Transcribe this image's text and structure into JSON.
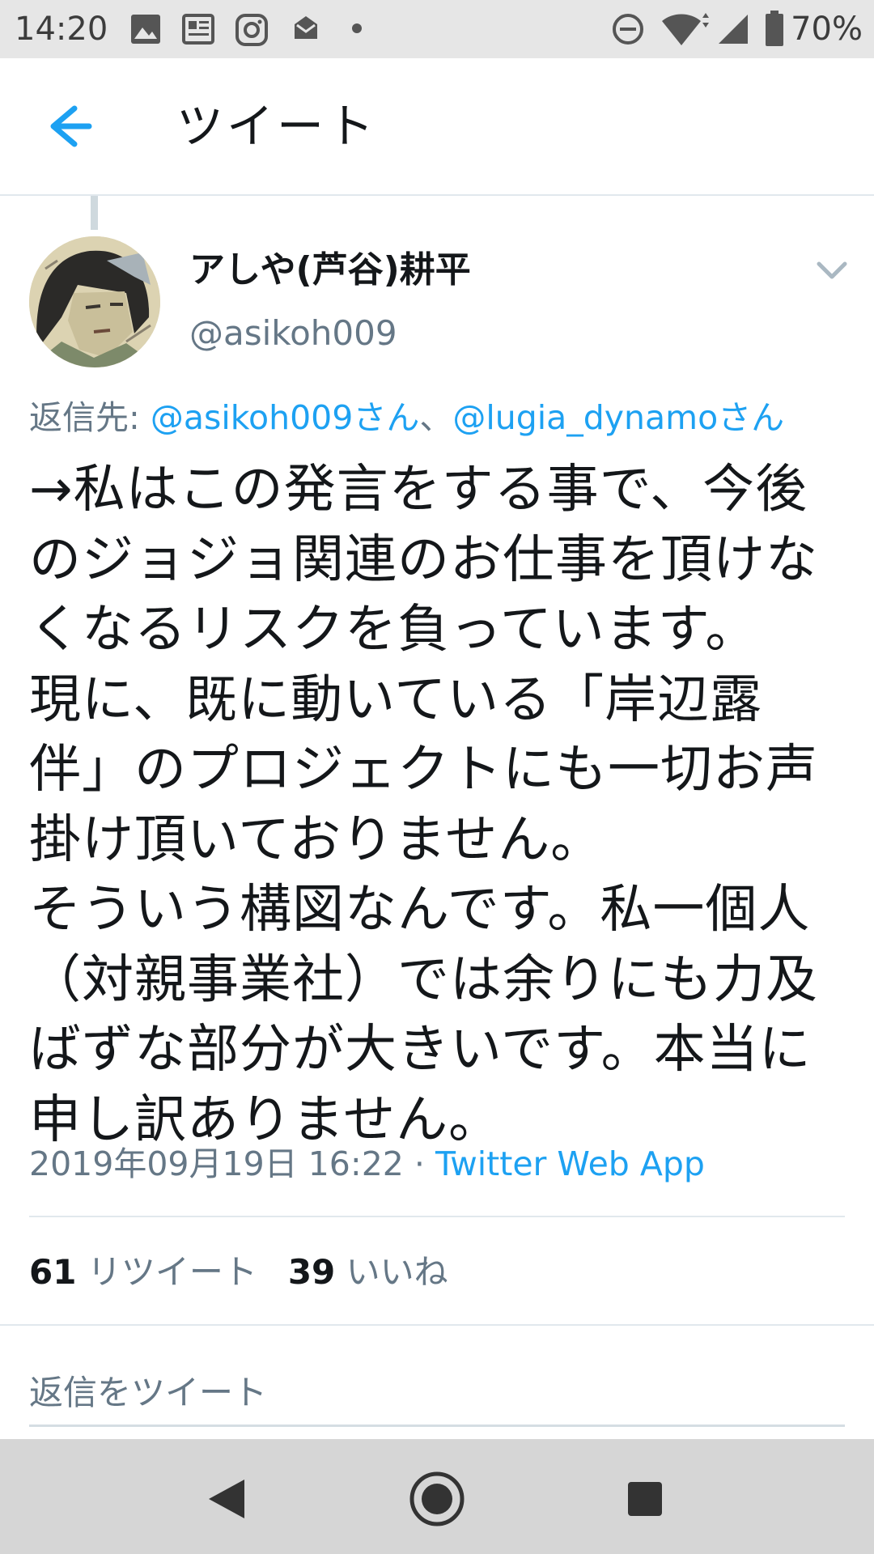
{
  "status_bar": {
    "time": "14:20",
    "battery_percent": "70%",
    "left_icons": [
      "image-icon",
      "news-icon",
      "instagram-icon",
      "mail-icon",
      "dot-icon"
    ],
    "right_icons": [
      "do-not-disturb-icon",
      "wifi-icon",
      "signal-icon",
      "battery-icon"
    ]
  },
  "header": {
    "title": "ツイート",
    "back_icon": "arrow-left-icon",
    "accent_color": "#1da1f2"
  },
  "tweet": {
    "author_name": "アしや(芦谷)耕平",
    "author_handle": "@asikoh009",
    "reply_label": "返信先: ",
    "reply_mentions": [
      "@asikoh009さん",
      "@lugia_dynamoさん"
    ],
    "reply_separator": "、",
    "body": "→私はこの発言をする事で、今後\nのジョジョ関連のお仕事を頂けな\nくなるリスクを負っています。\n現に、既に動いている「岸辺露\n伴」のプロジェクトにも一切お声\n掛け頂いておりません。\nそういう構図なんです。私一個人\n（対親事業社）では余りにも力及\nばずな部分が大きいです。本当に\n申し訳ありません。",
    "timestamp": "2019年09月19日 16:22",
    "meta_separator": " · ",
    "source": "Twitter Web App",
    "retweet_count": "61",
    "retweet_label": "リツイート",
    "like_count": "39",
    "like_label": "いいね"
  },
  "reply_box": {
    "placeholder": "返信をツイート"
  },
  "nav_bar": {
    "icons": [
      "back-triangle-icon",
      "home-circle-icon",
      "recents-square-icon"
    ]
  }
}
